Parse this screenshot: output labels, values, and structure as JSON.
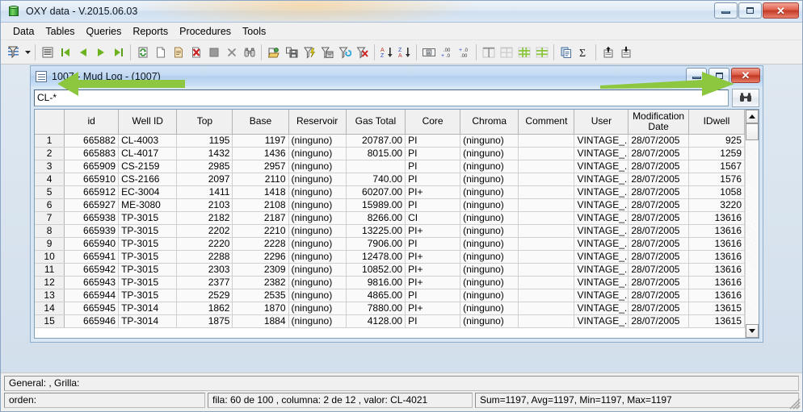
{
  "window": {
    "title": "OXY data - V.2015.06.03",
    "icon": "database-cylinder-icon",
    "buttons": {
      "minimize": "Minimize",
      "maximize": "Maximize",
      "close": "Close"
    }
  },
  "menubar": {
    "items": [
      {
        "label": "Data"
      },
      {
        "label": "Tables"
      },
      {
        "label": "Queries"
      },
      {
        "label": "Reports"
      },
      {
        "label": "Procedures"
      },
      {
        "label": "Tools"
      }
    ]
  },
  "toolbar": {
    "buttons": [
      {
        "name": "filter-sort-icon",
        "tip": "Filter / Sort"
      },
      {
        "name": "dropdown-caret-icon",
        "tip": "More"
      },
      {
        "name": "grid-view-icon",
        "tip": "Grid view"
      },
      {
        "name": "first-record-icon",
        "tip": "First record"
      },
      {
        "name": "previous-record-icon",
        "tip": "Previous record"
      },
      {
        "name": "next-record-icon",
        "tip": "Next record"
      },
      {
        "name": "last-record-icon",
        "tip": "Last record"
      },
      {
        "name": "refresh-icon",
        "tip": "Refresh"
      },
      {
        "name": "new-record-icon",
        "tip": "New record"
      },
      {
        "name": "edit-record-icon",
        "tip": "Edit record"
      },
      {
        "name": "delete-record-icon",
        "tip": "Delete record"
      },
      {
        "name": "stop-icon",
        "tip": "Stop"
      },
      {
        "name": "cancel-icon",
        "tip": "Cancel"
      },
      {
        "name": "binoculars-icon",
        "tip": "Find"
      },
      {
        "name": "open-query-icon",
        "tip": "Open query"
      },
      {
        "name": "save-query-icon",
        "tip": "Save query"
      },
      {
        "name": "apply-filter-icon",
        "tip": "Apply filter"
      },
      {
        "name": "filter-by-form-icon",
        "tip": "Filter by form"
      },
      {
        "name": "filter-window-icon",
        "tip": "Filter window"
      },
      {
        "name": "filter-refresh-icon",
        "tip": "Refresh filter"
      },
      {
        "name": "remove-filter-icon",
        "tip": "Remove filter"
      },
      {
        "name": "sort-ascending-icon",
        "tip": "Sort A to Z"
      },
      {
        "name": "sort-descending-icon",
        "tip": "Sort Z to A"
      },
      {
        "name": "format-cells-icon",
        "tip": "Format cells"
      },
      {
        "name": "increase-decimals-icon",
        "tip": "Increase decimals"
      },
      {
        "name": "decrease-decimals-icon",
        "tip": "Decrease decimals"
      },
      {
        "name": "freeze-columns-icon",
        "tip": "Freeze columns"
      },
      {
        "name": "table-borders-icon",
        "tip": "Table borders"
      },
      {
        "name": "group-columns-icon",
        "tip": "Group columns"
      },
      {
        "name": "group-rows-icon",
        "tip": "Group rows"
      },
      {
        "name": "copy-icon",
        "tip": "Copy"
      },
      {
        "name": "sum-icon",
        "tip": "Sum"
      },
      {
        "name": "export-up-icon",
        "tip": "Export"
      },
      {
        "name": "import-down-icon",
        "tip": "Import"
      }
    ]
  },
  "child_window": {
    "title": "1007 - Mud Log - (1007)",
    "icon": "table-window-icon",
    "buttons": {
      "minimize": "Minimize",
      "maximize": "Maximize",
      "close": "Close"
    }
  },
  "search": {
    "value": "CL-*",
    "placeholder": "",
    "find_button_icon": "binoculars-icon"
  },
  "annotations": {
    "left_arrow": {
      "name": "green-arrow-left",
      "color": "#8DC63F",
      "points_to": "search-input"
    },
    "right_arrow": {
      "name": "green-arrow-right",
      "color": "#8DC63F",
      "points_to": "find-button"
    }
  },
  "grid": {
    "row_header_label": "",
    "columns": [
      {
        "key": "rownum",
        "label": "",
        "align": "center",
        "width": 34
      },
      {
        "key": "id",
        "label": "id",
        "align": "right",
        "width": 62
      },
      {
        "key": "well_id",
        "label": "Well ID",
        "align": "left",
        "width": 67
      },
      {
        "key": "top",
        "label": "Top",
        "align": "right",
        "width": 64
      },
      {
        "key": "base",
        "label": "Base",
        "align": "right",
        "width": 64
      },
      {
        "key": "reservoir",
        "label": "Reservoir",
        "align": "left",
        "width": 66
      },
      {
        "key": "gas_total",
        "label": "Gas Total",
        "align": "right",
        "width": 68
      },
      {
        "key": "core",
        "label": "Core",
        "align": "left",
        "width": 63
      },
      {
        "key": "chroma",
        "label": "Chroma",
        "align": "left",
        "width": 67
      },
      {
        "key": "comment",
        "label": "Comment",
        "align": "left",
        "width": 64
      },
      {
        "key": "user",
        "label": "User",
        "align": "left",
        "width": 62
      },
      {
        "key": "modification_date",
        "label": "Modification Date",
        "align": "left",
        "width": 69
      },
      {
        "key": "idwell",
        "label": "IDwell",
        "align": "right",
        "width": 64
      }
    ],
    "rows": [
      {
        "rownum": "1",
        "id": "665882",
        "well_id": "CL-4003",
        "top": "1195",
        "base": "1197",
        "reservoir": "(ninguno)",
        "gas_total": "20787.00",
        "core": "PI",
        "chroma": "(ninguno)",
        "comment": "",
        "user": "VINTAGE_...",
        "modification_date": "28/07/2005",
        "idwell": "925"
      },
      {
        "rownum": "2",
        "id": "665883",
        "well_id": "CL-4017",
        "top": "1432",
        "base": "1436",
        "reservoir": "(ninguno)",
        "gas_total": "8015.00",
        "core": "PI",
        "chroma": "(ninguno)",
        "comment": "",
        "user": "VINTAGE_...",
        "modification_date": "28/07/2005",
        "idwell": "1259"
      },
      {
        "rownum": "3",
        "id": "665909",
        "well_id": "CS-2159",
        "top": "2985",
        "base": "2957",
        "reservoir": "(ninguno)",
        "gas_total": "",
        "core": "PI",
        "chroma": "(ninguno)",
        "comment": "",
        "user": "VINTAGE_...",
        "modification_date": "28/07/2005",
        "idwell": "1567"
      },
      {
        "rownum": "4",
        "id": "665910",
        "well_id": "CS-2166",
        "top": "2097",
        "base": "2110",
        "reservoir": "(ninguno)",
        "gas_total": "740.00",
        "core": "PI",
        "chroma": "(ninguno)",
        "comment": "",
        "user": "VINTAGE_...",
        "modification_date": "28/07/2005",
        "idwell": "1576"
      },
      {
        "rownum": "5",
        "id": "665912",
        "well_id": "EC-3004",
        "top": "1411",
        "base": "1418",
        "reservoir": "(ninguno)",
        "gas_total": "60207.00",
        "core": "PI+",
        "chroma": "(ninguno)",
        "comment": "",
        "user": "VINTAGE_...",
        "modification_date": "28/07/2005",
        "idwell": "1058"
      },
      {
        "rownum": "6",
        "id": "665927",
        "well_id": "ME-3080",
        "top": "2103",
        "base": "2108",
        "reservoir": "(ninguno)",
        "gas_total": "15989.00",
        "core": "PI",
        "chroma": "(ninguno)",
        "comment": "",
        "user": "VINTAGE_...",
        "modification_date": "28/07/2005",
        "idwell": "3220"
      },
      {
        "rownum": "7",
        "id": "665938",
        "well_id": "TP-3015",
        "top": "2182",
        "base": "2187",
        "reservoir": "(ninguno)",
        "gas_total": "8266.00",
        "core": "CI",
        "chroma": "(ninguno)",
        "comment": "",
        "user": "VINTAGE_...",
        "modification_date": "28/07/2005",
        "idwell": "13616"
      },
      {
        "rownum": "8",
        "id": "665939",
        "well_id": "TP-3015",
        "top": "2202",
        "base": "2210",
        "reservoir": "(ninguno)",
        "gas_total": "13225.00",
        "core": "PI+",
        "chroma": "(ninguno)",
        "comment": "",
        "user": "VINTAGE_...",
        "modification_date": "28/07/2005",
        "idwell": "13616"
      },
      {
        "rownum": "9",
        "id": "665940",
        "well_id": "TP-3015",
        "top": "2220",
        "base": "2228",
        "reservoir": "(ninguno)",
        "gas_total": "7906.00",
        "core": "PI",
        "chroma": "(ninguno)",
        "comment": "",
        "user": "VINTAGE_...",
        "modification_date": "28/07/2005",
        "idwell": "13616"
      },
      {
        "rownum": "10",
        "id": "665941",
        "well_id": "TP-3015",
        "top": "2288",
        "base": "2296",
        "reservoir": "(ninguno)",
        "gas_total": "12478.00",
        "core": "PI+",
        "chroma": "(ninguno)",
        "comment": "",
        "user": "VINTAGE_...",
        "modification_date": "28/07/2005",
        "idwell": "13616"
      },
      {
        "rownum": "11",
        "id": "665942",
        "well_id": "TP-3015",
        "top": "2303",
        "base": "2309",
        "reservoir": "(ninguno)",
        "gas_total": "10852.00",
        "core": "PI+",
        "chroma": "(ninguno)",
        "comment": "",
        "user": "VINTAGE_...",
        "modification_date": "28/07/2005",
        "idwell": "13616"
      },
      {
        "rownum": "12",
        "id": "665943",
        "well_id": "TP-3015",
        "top": "2377",
        "base": "2382",
        "reservoir": "(ninguno)",
        "gas_total": "9816.00",
        "core": "PI+",
        "chroma": "(ninguno)",
        "comment": "",
        "user": "VINTAGE_...",
        "modification_date": "28/07/2005",
        "idwell": "13616"
      },
      {
        "rownum": "13",
        "id": "665944",
        "well_id": "TP-3015",
        "top": "2529",
        "base": "2535",
        "reservoir": "(ninguno)",
        "gas_total": "4865.00",
        "core": "PI",
        "chroma": "(ninguno)",
        "comment": "",
        "user": "VINTAGE_...",
        "modification_date": "28/07/2005",
        "idwell": "13616"
      },
      {
        "rownum": "14",
        "id": "665945",
        "well_id": "TP-3014",
        "top": "1862",
        "base": "1870",
        "reservoir": "(ninguno)",
        "gas_total": "7880.00",
        "core": "PI+",
        "chroma": "(ninguno)",
        "comment": "",
        "user": "VINTAGE_...",
        "modification_date": "28/07/2005",
        "idwell": "13615"
      },
      {
        "rownum": "15",
        "id": "665946",
        "well_id": "TP-3014",
        "top": "1875",
        "base": "1884",
        "reservoir": "(ninguno)",
        "gas_total": "4128.00",
        "core": "PI",
        "chroma": "(ninguno)",
        "comment": "",
        "user": "VINTAGE_...",
        "modification_date": "28/07/2005",
        "idwell": "13615"
      }
    ]
  },
  "statusbar": {
    "general": "General: , Grilla:",
    "orden": "orden:",
    "position": "fila: 60 de 100 , columna: 2 de 12 , valor: CL-4021",
    "aggregates": "Sum=1197, Avg=1197, Min=1197, Max=1197"
  }
}
